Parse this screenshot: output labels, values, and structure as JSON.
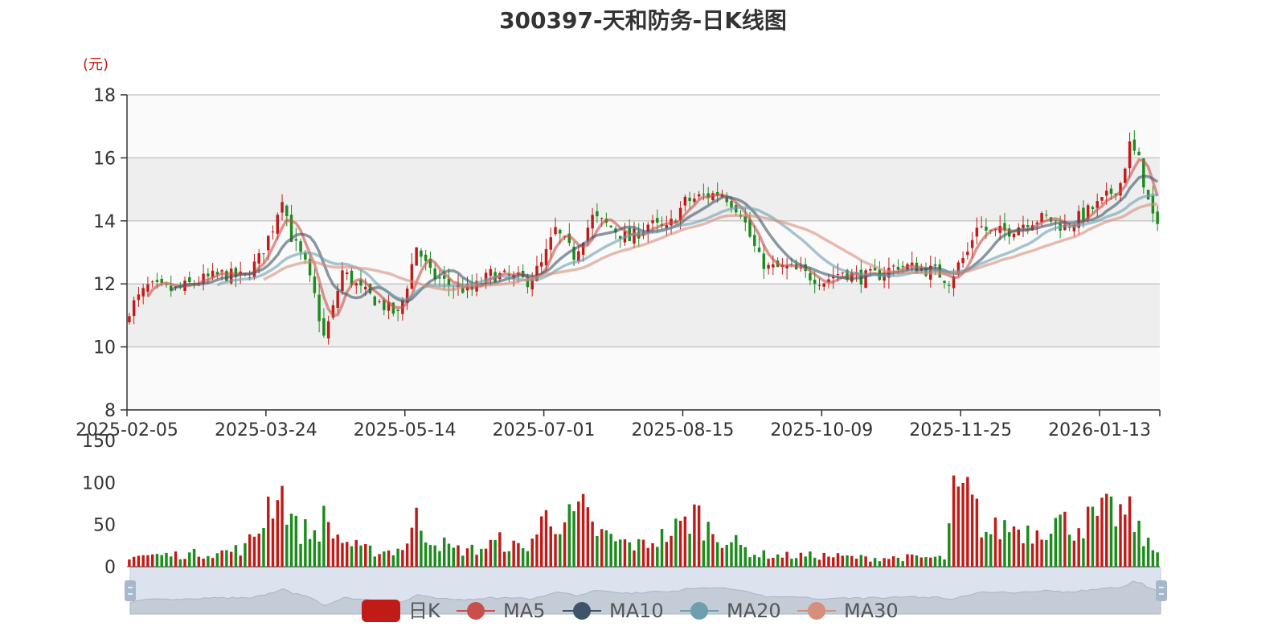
{
  "chart_data": [
    {
      "type": "candlestick",
      "title": "300397-天和防务-日K线图",
      "y_unit": "(元)",
      "ylim": [
        8,
        18
      ],
      "yticks": [
        8,
        10,
        12,
        14,
        16,
        18
      ],
      "x_tick_labels": [
        "2025-02-05",
        "2025-03-24",
        "2025-05-14",
        "2025-07-01",
        "2025-08-15",
        "2025-10-09",
        "2025-11-25",
        "2026-01-13"
      ],
      "x_tick_indices": [
        0,
        30,
        60,
        90,
        120,
        150,
        180,
        210
      ],
      "num_days": 223,
      "up_color": "#c11b17",
      "down_color": "#1b8c1b",
      "close_anchors": [
        [
          0,
          11.2
        ],
        [
          4,
          11.9
        ],
        [
          10,
          11.8
        ],
        [
          15,
          12.1
        ],
        [
          20,
          12.3
        ],
        [
          25,
          12.2
        ],
        [
          28,
          12.8
        ],
        [
          31,
          13.8
        ],
        [
          33,
          14.8
        ],
        [
          35,
          13.5
        ],
        [
          38,
          12.6
        ],
        [
          40,
          11.6
        ],
        [
          42,
          10.3
        ],
        [
          44,
          11.2
        ],
        [
          46,
          12.4
        ],
        [
          50,
          11.8
        ],
        [
          55,
          11.3
        ],
        [
          58,
          11.0
        ],
        [
          60,
          12.0
        ],
        [
          62,
          13.2
        ],
        [
          65,
          12.3
        ],
        [
          70,
          11.9
        ],
        [
          74,
          11.8
        ],
        [
          78,
          12.3
        ],
        [
          82,
          12.2
        ],
        [
          86,
          12.1
        ],
        [
          89,
          12.6
        ],
        [
          92,
          13.7
        ],
        [
          96,
          12.9
        ],
        [
          100,
          14.1
        ],
        [
          104,
          13.8
        ],
        [
          108,
          13.4
        ],
        [
          112,
          13.9
        ],
        [
          116,
          13.7
        ],
        [
          120,
          14.6
        ],
        [
          124,
          14.8
        ],
        [
          128,
          14.9
        ],
        [
          132,
          14.3
        ],
        [
          134,
          13.5
        ],
        [
          136,
          12.8
        ],
        [
          138,
          12.5
        ],
        [
          142,
          12.5
        ],
        [
          146,
          12.3
        ],
        [
          150,
          12.1
        ],
        [
          154,
          12.4
        ],
        [
          158,
          12.2
        ],
        [
          162,
          12.3
        ],
        [
          166,
          12.6
        ],
        [
          170,
          12.5
        ],
        [
          174,
          12.4
        ],
        [
          177,
          12.1
        ],
        [
          179,
          12.6
        ],
        [
          181,
          13.0
        ],
        [
          183,
          13.9
        ],
        [
          186,
          13.6
        ],
        [
          190,
          13.7
        ],
        [
          194,
          14.0
        ],
        [
          198,
          14.1
        ],
        [
          202,
          13.8
        ],
        [
          206,
          14.2
        ],
        [
          210,
          14.6
        ],
        [
          214,
          15.2
        ],
        [
          216,
          16.4
        ],
        [
          218,
          15.9
        ],
        [
          220,
          14.6
        ],
        [
          222,
          13.7
        ]
      ],
      "ma_series": [
        {
          "name": "MA5",
          "window": 5,
          "color": "#c9504a"
        },
        {
          "name": "MA10",
          "window": 10,
          "color": "#3d5568"
        },
        {
          "name": "MA20",
          "window": 20,
          "color": "#6f9fae"
        },
        {
          "name": "MA30",
          "window": 30,
          "color": "#d58f7c"
        }
      ],
      "legend": [
        "日K",
        "MA5",
        "MA10",
        "MA20",
        "MA30"
      ]
    },
    {
      "type": "bar",
      "name": "volume",
      "ylim": [
        0,
        150
      ],
      "yticks": [
        0,
        50,
        100,
        150
      ],
      "volume_anchors": [
        [
          0,
          13
        ],
        [
          10,
          14
        ],
        [
          20,
          17
        ],
        [
          25,
          22
        ],
        [
          28,
          45
        ],
        [
          30,
          75
        ],
        [
          32,
          95
        ],
        [
          34,
          75
        ],
        [
          36,
          45
        ],
        [
          40,
          40
        ],
        [
          42,
          55
        ],
        [
          45,
          35
        ],
        [
          50,
          20
        ],
        [
          55,
          18
        ],
        [
          58,
          20
        ],
        [
          60,
          30
        ],
        [
          62,
          55
        ],
        [
          65,
          35
        ],
        [
          70,
          20
        ],
        [
          75,
          20
        ],
        [
          80,
          30
        ],
        [
          85,
          20
        ],
        [
          88,
          40
        ],
        [
          90,
          60
        ],
        [
          95,
          55
        ],
        [
          98,
          65
        ],
        [
          100,
          45
        ],
        [
          105,
          30
        ],
        [
          110,
          25
        ],
        [
          115,
          35
        ],
        [
          120,
          50
        ],
        [
          122,
          65
        ],
        [
          125,
          45
        ],
        [
          130,
          30
        ],
        [
          135,
          15
        ],
        [
          140,
          13
        ],
        [
          150,
          13
        ],
        [
          160,
          10
        ],
        [
          170,
          11
        ],
        [
          176,
          10
        ],
        [
          178,
          80
        ],
        [
          181,
          85
        ],
        [
          185,
          40
        ],
        [
          190,
          48
        ],
        [
          195,
          42
        ],
        [
          200,
          55
        ],
        [
          204,
          48
        ],
        [
          208,
          56
        ],
        [
          212,
          65
        ],
        [
          216,
          60
        ],
        [
          220,
          25
        ],
        [
          222,
          17
        ]
      ]
    }
  ],
  "legend": {
    "items": [
      {
        "label": "日K",
        "color": "#c11b17",
        "shape": "rect"
      },
      {
        "label": "MA5",
        "color": "#c9504a",
        "shape": "line-circle"
      },
      {
        "label": "MA10",
        "color": "#3d5568",
        "shape": "line-circle"
      },
      {
        "label": "MA20",
        "color": "#6f9fae",
        "shape": "line-circle"
      },
      {
        "label": "MA30",
        "color": "#d58f7c",
        "shape": "line-circle"
      }
    ]
  }
}
